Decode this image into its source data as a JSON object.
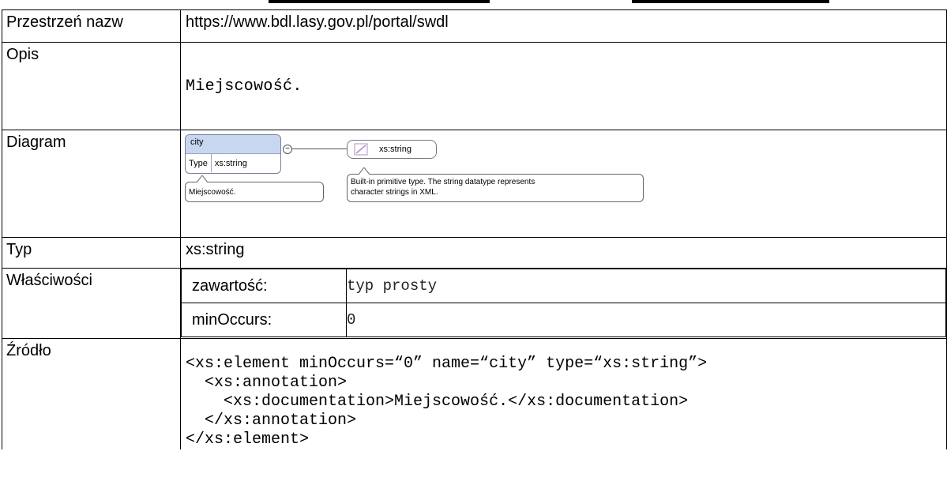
{
  "labels": {
    "namespace": "Przestrzeń nazw",
    "description": "Opis",
    "diagram": "Diagram",
    "type": "Typ",
    "properties": "Właściwości",
    "source": "Źródło"
  },
  "namespace_value": "https://www.bdl.lasy.gov.pl/portal/swdl",
  "description_value": "Miejscowość.",
  "diagram": {
    "element_name": "city",
    "type_label": "Type",
    "type_value": "xs:string",
    "element_doc": "Miejscowość.",
    "type_box_label": "xs:string",
    "type_doc_line1": "Built-in primitive type. The string datatype represents",
    "type_doc_line2": "character strings in XML."
  },
  "type_value": "xs:string",
  "properties": [
    {
      "key": "zawartość:",
      "value": "typ prosty"
    },
    {
      "key": "minOccurs:",
      "value": "0"
    }
  ],
  "source_code": "<xs:element minOccurs=“0” name=“city” type=“xs:string”>\n  <xs:annotation>\n    <xs:documentation>Miejscowość.</xs:documentation>\n  </xs:annotation>\n</xs:element>",
  "colors": {
    "element_header": "#c8d7f0",
    "border": "#000000"
  }
}
